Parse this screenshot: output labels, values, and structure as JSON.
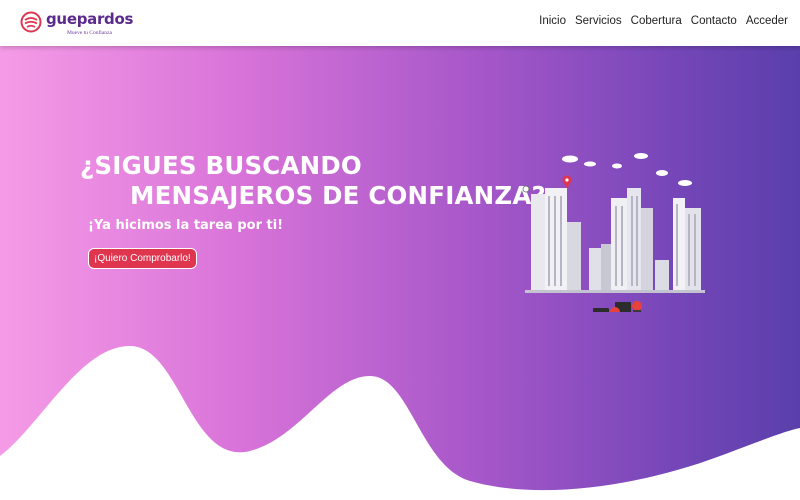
{
  "brand": {
    "name": "guepardos",
    "tagline": "Mueve tu Confianza",
    "accent": "#5b2a8c",
    "logo_color": "#e0354f"
  },
  "nav": {
    "items": [
      "Inicio",
      "Servicios",
      "Cobertura",
      "Contacto",
      "Acceder"
    ]
  },
  "hero": {
    "title_line1": "¿SIGUES BUSCANDO",
    "title_line2": "MENSAJEROS DE CONFIANZA?",
    "subtitle": "¡Ya hicimos la tarea por ti!",
    "cta_label": "¡Quiero Comprobarlo!",
    "cta_color": "#e0354f",
    "gradient": [
      "#f59be6",
      "#d873d9",
      "#a657c9",
      "#7446b8",
      "#5a3fab"
    ],
    "illustration": [
      "city-skyline-icon",
      "delivery-scooter-icon",
      "map-pin-icon",
      "cloud-icon"
    ]
  }
}
